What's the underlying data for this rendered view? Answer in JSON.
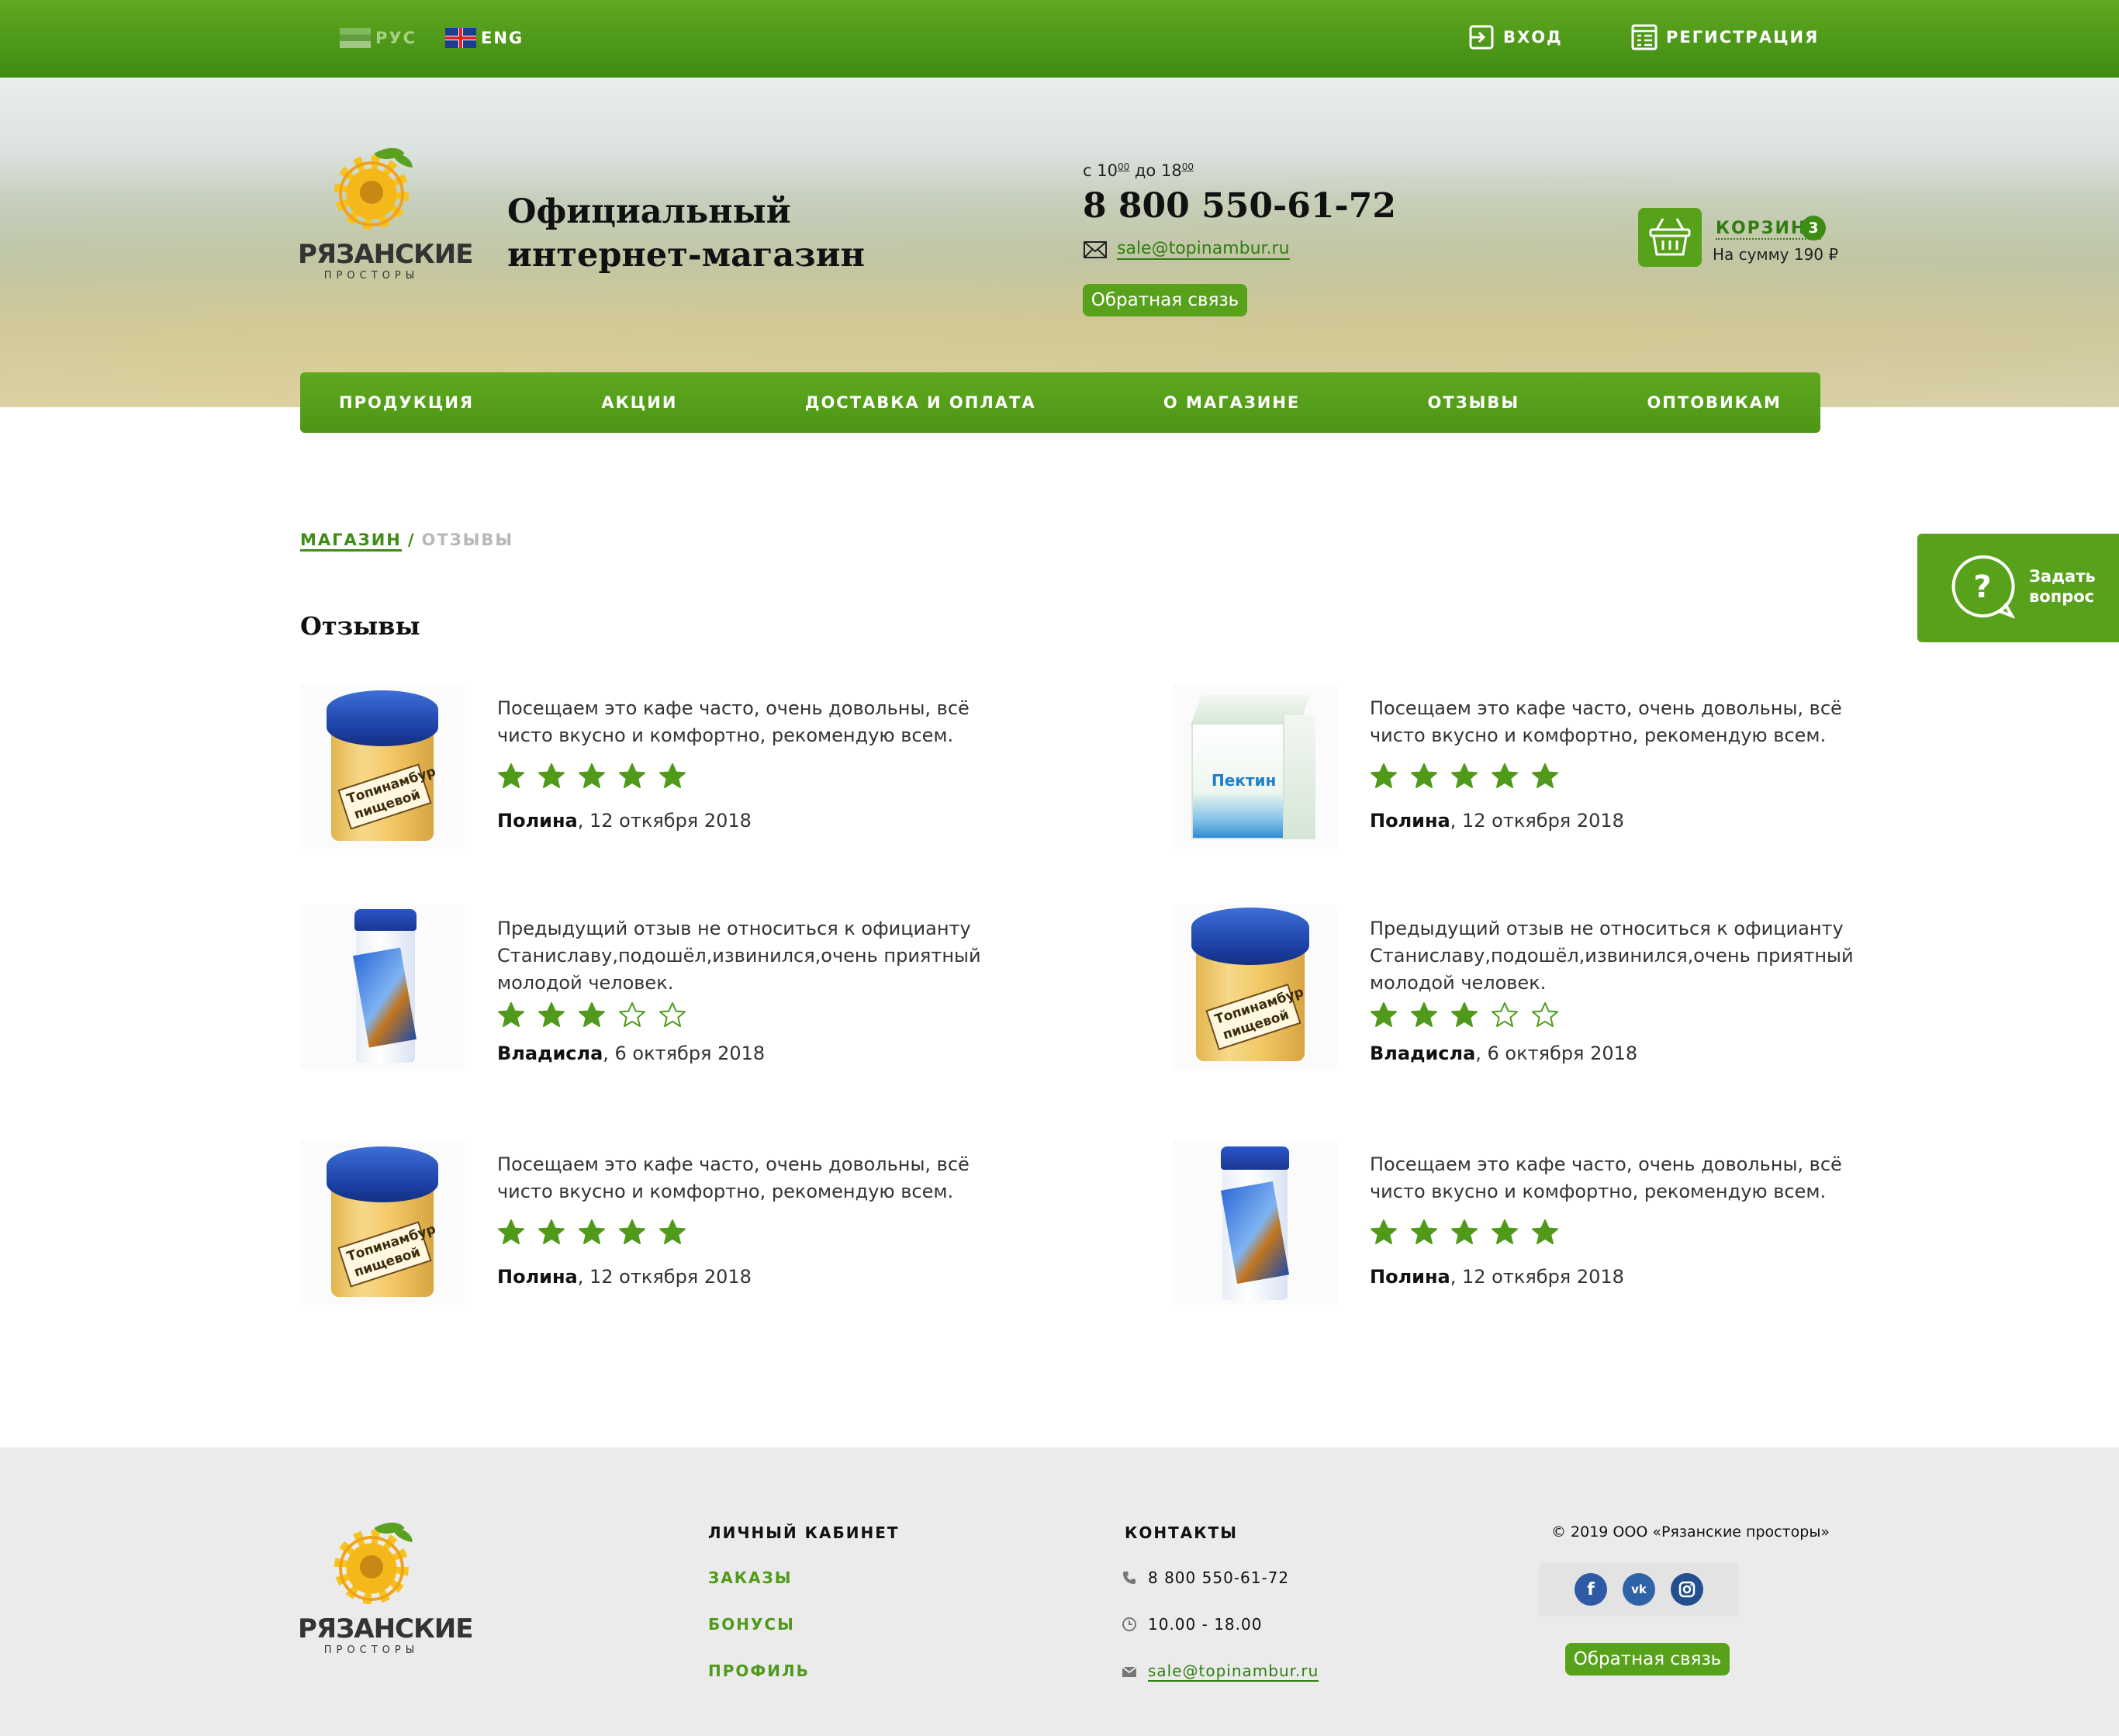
{
  "topbar": {
    "lang_ru": "РУС",
    "lang_en": "ENG",
    "login": "ВХОД",
    "register": "РЕГИСТРАЦИЯ"
  },
  "brand": {
    "name": "РЯЗАНСКИЕ",
    "subname": "ПРОСТОРЫ",
    "tagline_line1": "Официальный",
    "tagline_line2": "интернет-магазин"
  },
  "contacts": {
    "hours_from_prefix": "с 10",
    "hours_from_minutes": "00",
    "hours_to_prefix": " до 18",
    "hours_to_minutes": "00",
    "phone": "8 800 550-61-72",
    "email": "sale@topinambur.ru",
    "feedback_button": "Обратная связь"
  },
  "cart": {
    "label": "КОРЗИНА",
    "count": "3",
    "sum": "На сумму 190 ₽"
  },
  "nav": [
    "ПРОДУКЦИЯ",
    "АКЦИИ",
    "ДОСТАВКА И ОПЛАТА",
    "О МАГАЗИНЕ",
    "ОТЗЫВЫ",
    "ОПТОВИКАМ"
  ],
  "breadcrumb": {
    "root": "МАГАЗИН",
    "separator": "/",
    "current": "ОТЗЫВЫ"
  },
  "page_title": "Отзывы",
  "ask_question": {
    "line1": "Задать",
    "line2": "вопрос"
  },
  "reviews": [
    {
      "text": "Посещаем это кафе часто,  очень довольны, всё чисто вкусно и комфортно, рекомендую всем.",
      "rating": 5,
      "author": "Полина",
      "date": ", 12 откября 2018",
      "product": "jar",
      "product_label": "Топинамбур пищевой"
    },
    {
      "text": "Посещаем это кафе часто,  очень довольны, всё чисто вкусно и комфортно, рекомендую всем.",
      "rating": 5,
      "author": "Полина",
      "date": ", 12 откября 2018",
      "product": "box",
      "product_label": "Пектин"
    },
    {
      "text": "Предыдущий отзыв не относиться к официанту Станиславу,подошёл,извинился,очень приятный молодой человек.",
      "rating": 3,
      "author": "Владисла",
      "date": ", 6 октября 2018",
      "product": "tube",
      "product_label": ""
    },
    {
      "text": "Предыдущий отзыв не относиться к официанту Станиславу,подошёл,извинился,очень приятный молодой человек.",
      "rating": 3,
      "author": "Владисла",
      "date": ", 6 октября 2018",
      "product": "jar",
      "product_label": "Топинамбур пищевой"
    },
    {
      "text": "Посещаем это кафе часто,  очень довольны, всё чисто вкусно и комфортно, рекомендую всем.",
      "rating": 5,
      "author": "Полина",
      "date": ", 12 откября 2018",
      "product": "jar",
      "product_label": "Топинамбур пищевой"
    },
    {
      "text": "Посещаем это кафе часто,  очень довольны, всё чисто вкусно и комфортно, рекомендую всем.",
      "rating": 5,
      "author": "Полина",
      "date": ", 12 откября 2018",
      "product": "tube",
      "product_label": ""
    }
  ],
  "footer": {
    "cabinet_title": "ЛИЧНЫЙ КАБИНЕТ",
    "cabinet_links": [
      "ЗАКАЗЫ",
      "БОНУСЫ",
      "ПРОФИЛЬ"
    ],
    "contacts_title": "КОНТАКТЫ",
    "phone": "8 800 550-61-72",
    "hours": "10.00 - 18.00",
    "email": "sale@topinambur.ru",
    "copyright": "© 2019 ООО «Рязанские просторы»",
    "feedback_button": "Обратная связь",
    "socials": [
      "facebook-icon",
      "vk-icon",
      "instagram-icon"
    ]
  },
  "colors": {
    "accent": "#58a21b",
    "accent_dark": "#3f8c14",
    "star": "#4f9a1a"
  }
}
